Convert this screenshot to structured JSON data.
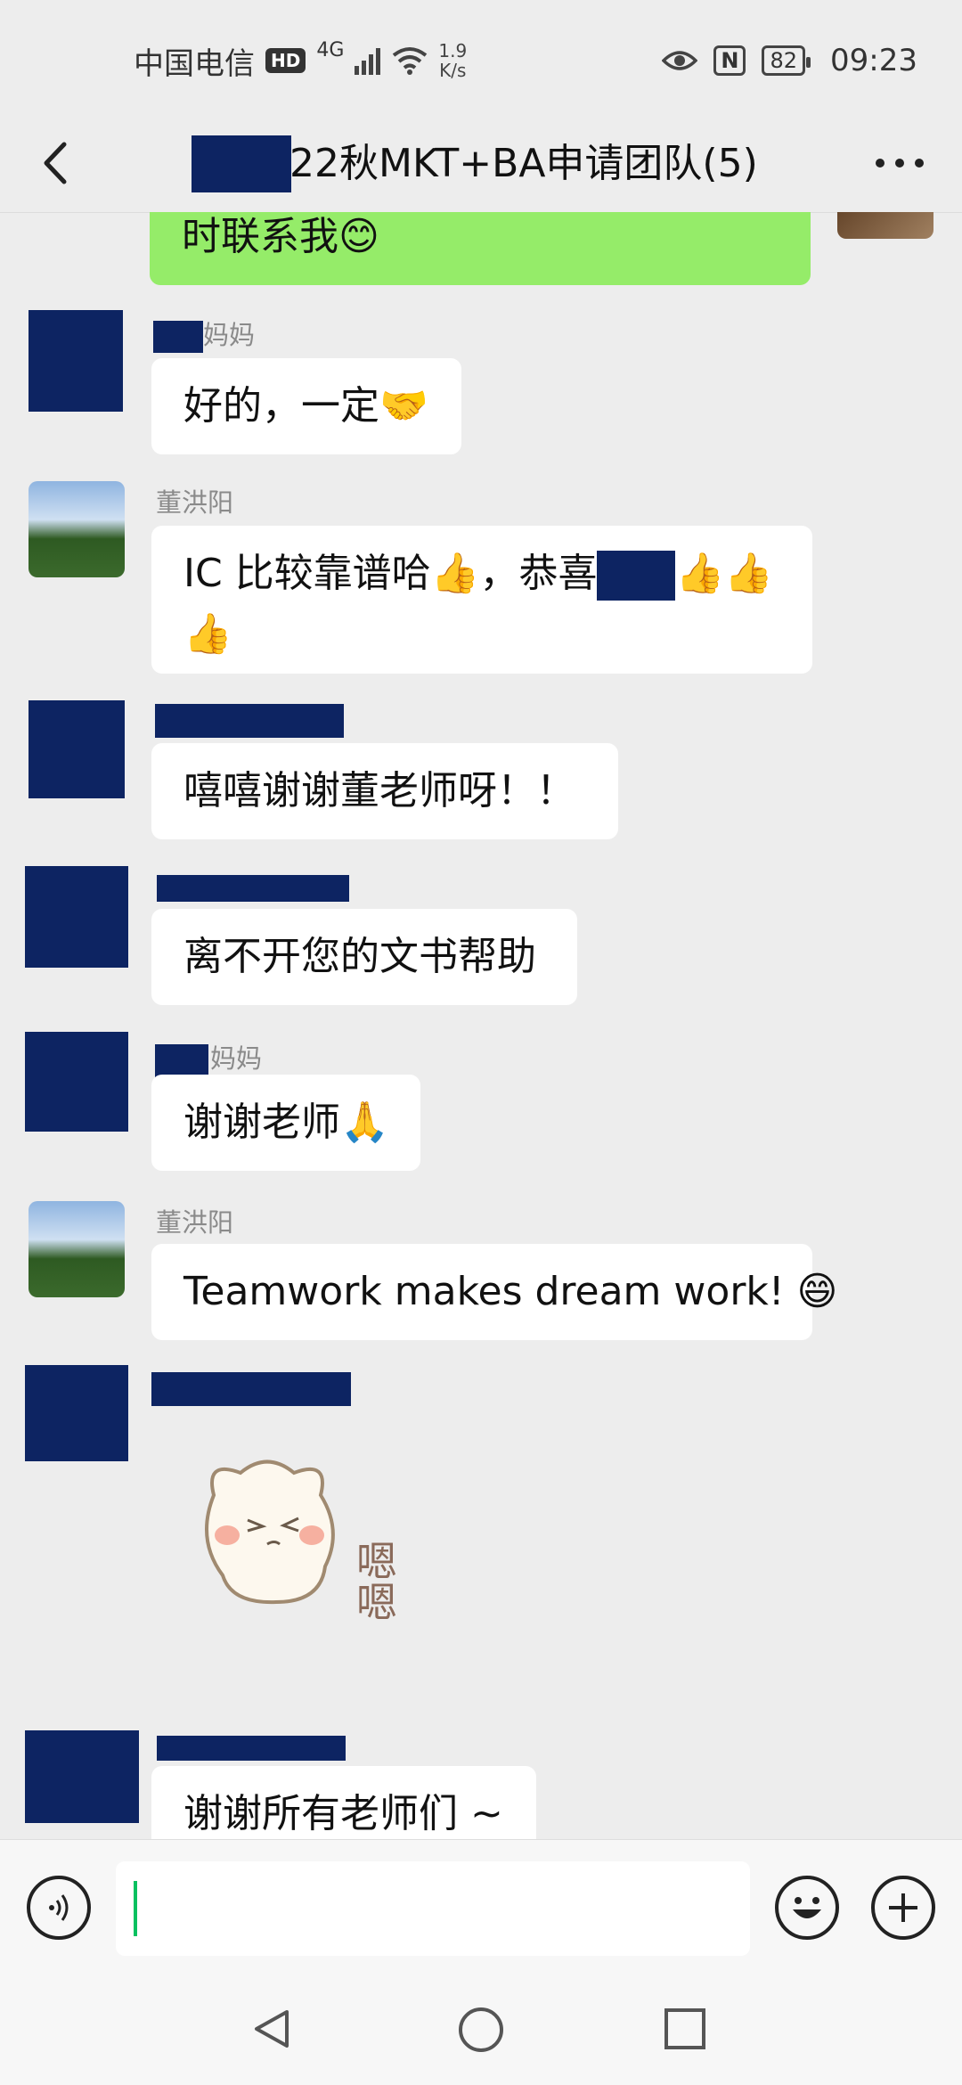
{
  "status_bar": {
    "carrier": "中国电信",
    "hd": "HD",
    "network": "4G",
    "speed_value": "1.9",
    "speed_unit": "K/s",
    "nfc": "N",
    "battery": "82",
    "time": "09:23"
  },
  "header": {
    "title": "22秋MKT+BA申请团队(5)",
    "more_label": "···"
  },
  "messages": [
    {
      "sender": "",
      "text": "时联系我😊",
      "mine": true
    },
    {
      "sender": "妈妈",
      "text": "好的，一定🤝"
    },
    {
      "sender": "董洪阳",
      "text": "IC 比较靠谱哈👍，恭喜",
      "text_after": "👍👍",
      "text_line2": "👍"
    },
    {
      "sender": "",
      "text": "嘻嘻谢谢董老师呀！！"
    },
    {
      "sender": "",
      "text": "离不开您的文书帮助"
    },
    {
      "sender": "妈妈",
      "text": "谢谢老师🙏"
    },
    {
      "sender": "董洪阳",
      "text": "Teamwork makes dream work! 😄"
    },
    {
      "sender": "",
      "sticker_text": "嗯嗯"
    },
    {
      "sender": "",
      "text": "谢谢所有老师们 ~"
    }
  ],
  "input_bar": {
    "voice_icon": "voice-icon",
    "emoji_icon": "emoji-icon",
    "plus_icon": "plus-icon"
  }
}
